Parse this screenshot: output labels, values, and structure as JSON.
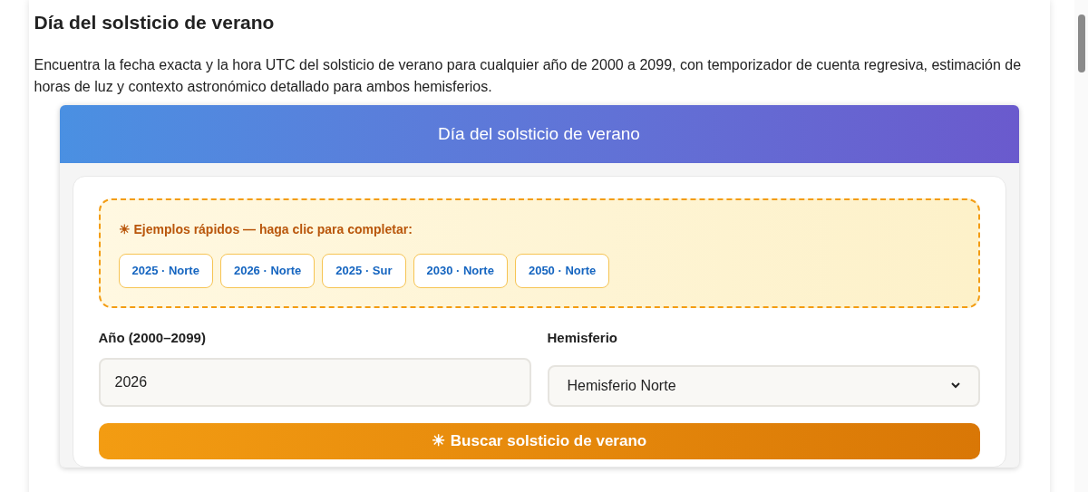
{
  "page": {
    "title": "Día del solsticio de verano",
    "intro": "Encuentra la fecha exacta y la hora UTC del solsticio de verano para cualquier año de 2000 a 2099, con temporizador de cuenta regresiva, estimación de horas de luz y contexto astronómico detallado para ambos hemisferios."
  },
  "widget": {
    "header": "Día del solsticio de verano",
    "examples": {
      "icon": "☀",
      "label": "Ejemplos rápidos — haga clic para completar:",
      "items": [
        "2025 · Norte",
        "2026 · Norte",
        "2025 · Sur",
        "2030 · Norte",
        "2050 · Norte"
      ]
    },
    "year_field": {
      "label": "Año (2000–2099)",
      "value": "2026"
    },
    "hemisphere_field": {
      "label": "Hemisferio",
      "value": "Hemisferio Norte"
    },
    "submit": {
      "icon": "☀",
      "label": "Buscar solsticio de verano"
    }
  }
}
